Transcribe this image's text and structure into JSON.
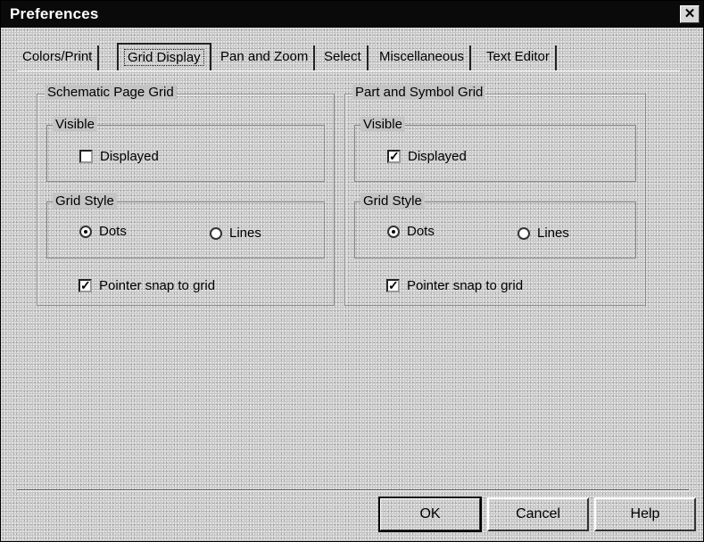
{
  "window": {
    "title": "Preferences",
    "close_glyph": "✕"
  },
  "tabs": [
    {
      "label": "Colors/Print"
    },
    {
      "label": "Grid Display",
      "active": true
    },
    {
      "label": "Pan and Zoom"
    },
    {
      "label": "Select"
    },
    {
      "label": "Miscellaneous"
    },
    {
      "label": "Text Editor"
    }
  ],
  "schematic": {
    "title": "Schematic Page Grid",
    "visible_label": "Visible",
    "displayed_label": "Displayed",
    "displayed_checked": false,
    "grid_style_label": "Grid Style",
    "dots_label": "Dots",
    "lines_label": "Lines",
    "grid_style_selected": "Dots",
    "snap_label": "Pointer snap to grid",
    "snap_checked": true
  },
  "part": {
    "title": "Part and Symbol Grid",
    "visible_label": "Visible",
    "displayed_label": "Displayed",
    "displayed_checked": true,
    "grid_style_label": "Grid Style",
    "dots_label": "Dots",
    "lines_label": "Lines",
    "grid_style_selected": "Dots",
    "snap_label": "Pointer snap to grid",
    "snap_checked": true
  },
  "buttons": {
    "ok": "OK",
    "cancel": "Cancel",
    "help": "Help"
  },
  "icons": {
    "close": "close-icon",
    "check": "checkmark-icon",
    "radio": "radio-dot-icon"
  }
}
